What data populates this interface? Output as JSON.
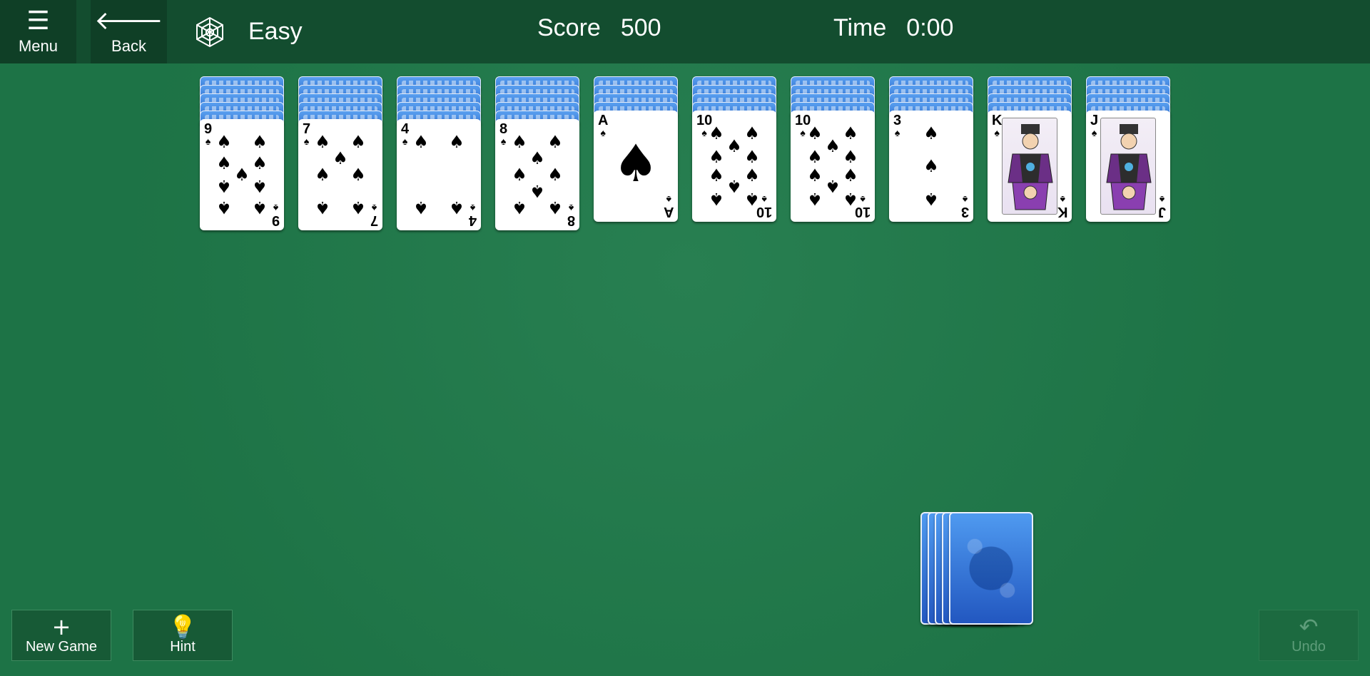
{
  "topbar": {
    "menu": {
      "icon": "hamburger-icon",
      "label": "Menu"
    },
    "back": {
      "icon": "back-arrow-icon",
      "label": "Back"
    },
    "game_icon": "spider-web-icon",
    "difficulty": "Easy",
    "score_label": "Score",
    "score_value": "500",
    "time_label": "Time",
    "time_value": "0:00"
  },
  "tableau": [
    {
      "hidden": 5,
      "card": {
        "rank": "9",
        "suit": "♠",
        "type": "pips"
      }
    },
    {
      "hidden": 5,
      "card": {
        "rank": "7",
        "suit": "♠",
        "type": "pips"
      }
    },
    {
      "hidden": 5,
      "card": {
        "rank": "4",
        "suit": "♠",
        "type": "pips"
      }
    },
    {
      "hidden": 5,
      "card": {
        "rank": "8",
        "suit": "♠",
        "type": "pips"
      }
    },
    {
      "hidden": 4,
      "card": {
        "rank": "A",
        "suit": "♠",
        "type": "ace"
      }
    },
    {
      "hidden": 4,
      "card": {
        "rank": "10",
        "suit": "♠",
        "type": "pips"
      }
    },
    {
      "hidden": 4,
      "card": {
        "rank": "10",
        "suit": "♠",
        "type": "pips"
      }
    },
    {
      "hidden": 4,
      "card": {
        "rank": "3",
        "suit": "♠",
        "type": "pips"
      }
    },
    {
      "hidden": 4,
      "card": {
        "rank": "K",
        "suit": "♠",
        "type": "face"
      }
    },
    {
      "hidden": 4,
      "card": {
        "rank": "J",
        "suit": "♠",
        "type": "face"
      }
    }
  ],
  "stock": {
    "count": 5,
    "icon": "card-back"
  },
  "bottom": {
    "new_game": {
      "icon": "plus-icon",
      "label": "New Game"
    },
    "hint": {
      "icon": "lightbulb-icon",
      "label": "Hint"
    },
    "undo": {
      "icon": "undo-icon",
      "label": "Undo",
      "enabled": false
    }
  },
  "colors": {
    "felt": "#1f7a4a",
    "topbar": "#134d2f",
    "card_back": "#2a6fd6"
  }
}
